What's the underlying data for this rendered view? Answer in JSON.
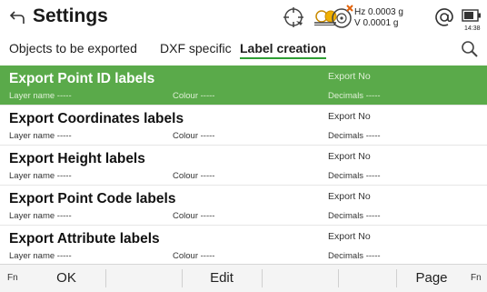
{
  "header": {
    "title": "Settings",
    "hz_line": "Hz 0.0003 g",
    "v_line": "V  0.0001 g",
    "clock": "14:38"
  },
  "icons": {
    "back": "back-arrow-icon",
    "target": "target-crosshair-icon",
    "prism": "prism-icon",
    "compensator": "compensator-icon",
    "at": "at-sign-icon",
    "battery": "battery-icon",
    "search": "search-icon"
  },
  "tabs": [
    {
      "label": "Objects to be exported",
      "active": false
    },
    {
      "label": "DXF specific",
      "active": false
    },
    {
      "label": "Label creation",
      "active": true
    }
  ],
  "rows": [
    {
      "title": "Export Point ID labels",
      "layer": "Layer name -----",
      "colour": "Colour -----",
      "export": "Export  No",
      "decimals": "Decimals -----",
      "selected": true
    },
    {
      "title": "Export Coordinates labels",
      "layer": "Layer name -----",
      "colour": "Colour -----",
      "export": "Export  No",
      "decimals": "Decimals -----",
      "selected": false
    },
    {
      "title": "Export Height labels",
      "layer": "Layer name -----",
      "colour": "Colour -----",
      "export": "Export  No",
      "decimals": "Decimals -----",
      "selected": false
    },
    {
      "title": "Export Point Code labels",
      "layer": "Layer name -----",
      "colour": "Colour -----",
      "export": "Export  No",
      "decimals": "Decimals -----",
      "selected": false
    },
    {
      "title": "Export Attribute labels",
      "layer": "Layer name -----",
      "colour": "Colour -----",
      "export": "Export  No",
      "decimals": "Decimals -----",
      "selected": false
    }
  ],
  "softkeys": {
    "fn_left": "Fn",
    "ok": "OK",
    "edit": "Edit",
    "page": "Page",
    "fn_right": "Fn"
  },
  "colors": {
    "accent": "#5aaa4a",
    "tab_underline": "#2e9e34"
  }
}
